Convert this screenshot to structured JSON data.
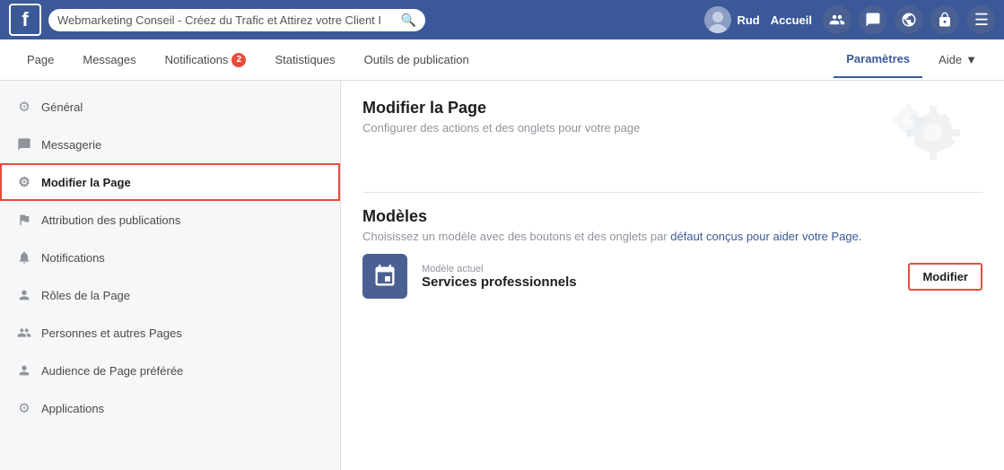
{
  "topbar": {
    "logo": "f",
    "search_placeholder": "Webmarketing Conseil - Créez du Trafic et Attirez votre Client I",
    "user_name": "Rud",
    "nav_accueil": "Accueil"
  },
  "subnav": {
    "items": [
      {
        "label": "Page",
        "active": false,
        "badge": null
      },
      {
        "label": "Messages",
        "active": false,
        "badge": null
      },
      {
        "label": "Notifications",
        "active": false,
        "badge": "2"
      },
      {
        "label": "Statistiques",
        "active": false,
        "badge": null
      },
      {
        "label": "Outils de publication",
        "active": false,
        "badge": null
      }
    ],
    "right_items": [
      {
        "label": "Paramètres",
        "active": true
      },
      {
        "label": "Aide",
        "active": false,
        "arrow": true
      }
    ]
  },
  "sidebar": {
    "items": [
      {
        "icon": "⚙",
        "label": "Général",
        "active": false
      },
      {
        "icon": "💬",
        "label": "Messagerie",
        "active": false
      },
      {
        "icon": "⚙",
        "label": "Modifier la Page",
        "active": true
      },
      {
        "icon": "🚩",
        "label": "Attribution des publications",
        "active": false
      },
      {
        "icon": "🔔",
        "label": "Notifications",
        "active": false
      },
      {
        "icon": "👤",
        "label": "Rôles de la Page",
        "active": false
      },
      {
        "icon": "👥",
        "label": "Personnes et autres Pages",
        "active": false
      },
      {
        "icon": "👤",
        "label": "Audience de Page préférée",
        "active": false
      },
      {
        "icon": "⚙",
        "label": "Applications",
        "active": false
      }
    ]
  },
  "content": {
    "section1": {
      "title": "Modifier la Page",
      "desc": "Configurer des actions et des onglets pour votre page"
    },
    "section2": {
      "title": "Modèles",
      "desc_plain": "Choisissez un modèle avec des boutons et des onglets par ",
      "desc_link": "défaut conçus pour aider votre Page.",
      "modele_actuel": "Modèle actuel",
      "modele_name": "Services professionnels",
      "modifier_label": "Modifier"
    }
  }
}
